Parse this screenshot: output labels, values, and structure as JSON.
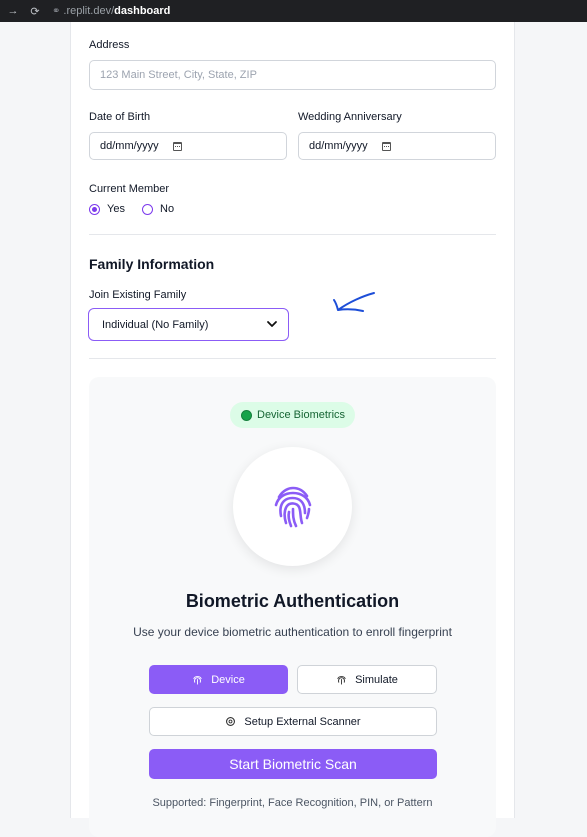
{
  "browser": {
    "url_domain": ".replit.dev/",
    "url_path": "dashboard"
  },
  "form": {
    "address": {
      "label": "Address",
      "placeholder": "123 Main Street, City, State, ZIP"
    },
    "dob": {
      "label": "Date of Birth",
      "value": "dd/mm/yyyy"
    },
    "anniversary": {
      "label": "Wedding Anniversary",
      "value": "dd/mm/yyyy"
    },
    "member": {
      "label": "Current Member",
      "options": [
        "Yes",
        "No"
      ],
      "selected": "Yes"
    }
  },
  "family": {
    "title": "Family Information",
    "join_label": "Join Existing Family",
    "selected_value": "Individual (No Family)"
  },
  "biometric": {
    "badge": "Device Biometrics",
    "title": "Biometric Authentication",
    "subtitle": "Use your device biometric authentication to enroll fingerprint",
    "device_button": "Device",
    "simulate_button": "Simulate",
    "external_button": "Setup External Scanner",
    "start_button": "Start Biometric Scan",
    "supported": "Supported: Fingerprint, Face Recognition, PIN, or Pattern"
  },
  "colors": {
    "accent": "#8b5cf6",
    "badge_bg": "#dcfce7",
    "badge_dot": "#16a34a",
    "annotation": "#1d4ed8"
  },
  "icons": [
    "back-arrow-icon",
    "reload-icon",
    "link-icon",
    "calendar-icon",
    "chevron-down-icon",
    "fingerprint-icon",
    "gear-icon"
  ]
}
